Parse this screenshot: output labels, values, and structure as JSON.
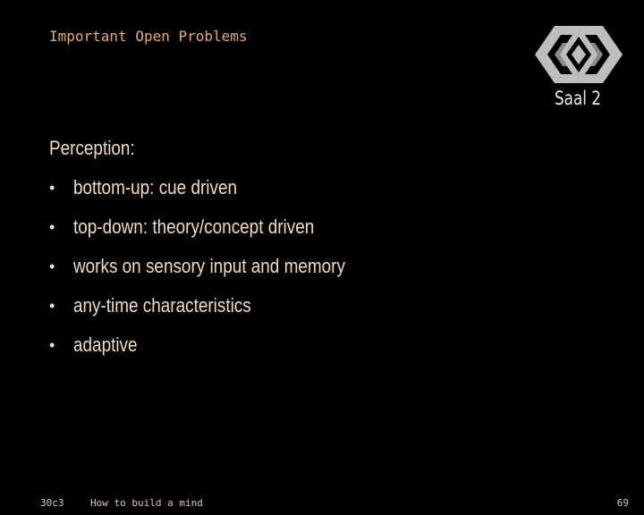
{
  "slide": {
    "title": "Important Open Problems",
    "heading": "Perception:",
    "bullets": [
      "bottom-up: cue driven",
      "top-down: theory/concept driven",
      "works on sensory input and memory",
      "any-time characteristics",
      "adaptive"
    ],
    "bullet_glyph": "•"
  },
  "overlay": {
    "logo_icon": "30c3-logo-icon",
    "room": "Saal 2"
  },
  "footer": {
    "event": "30c3",
    "talk": "How to build a mind",
    "page": "69"
  },
  "colors": {
    "background": "#000000",
    "title": "#e8a86a",
    "body_text": "#f2dcb4",
    "footer_text": "#d8c8a8",
    "logo": "#c8c8c8"
  }
}
